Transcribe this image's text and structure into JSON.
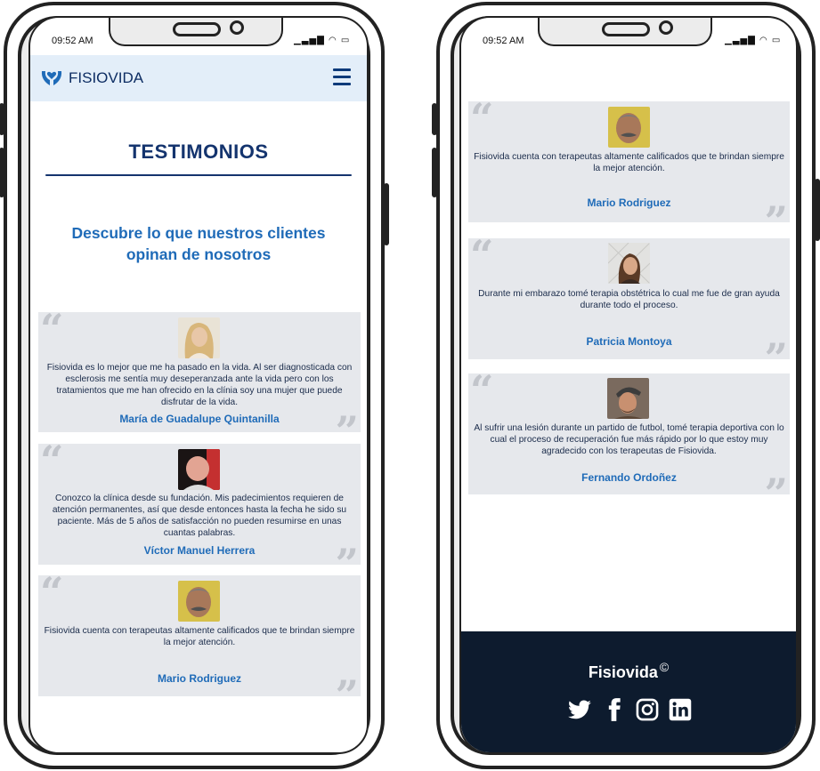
{
  "status_bar": {
    "time": "09:52 AM"
  },
  "header": {
    "brand": "FISIOVIDA"
  },
  "page": {
    "title": "TESTIMONIOS",
    "subtitle_line1": "Descubre lo que nuestros clientes",
    "subtitle_line2": "opinan de nosotros"
  },
  "testimonials": [
    {
      "text": "Fisiovida es lo mejor que me ha pasado en la vida. Al ser diagnosticada con esclerosis me sentía muy deseperanzada ante la vida pero con los tratamientos que me han ofrecido en la clínia soy una mujer que puede disfrutar de la vida.",
      "author": "María de Guadalupe Quintanilla"
    },
    {
      "text": "Conozco la clínica desde su fundación. Mis padecimientos requieren de atención permanentes, así que desde entonces hasta la fecha he sido su paciente. Más de 5 años de satisfacción no pueden resumirse en unas cuantas palabras.",
      "author": "Víctor Manuel Herrera"
    },
    {
      "text": "Fisiovida cuenta con terapeutas altamente calificados que te brindan siempre la mejor atención.",
      "author": "Mario Rodriguez"
    },
    {
      "text": "Durante mi embarazo tomé terapia obstétrica lo cual me fue de gran ayuda durante todo el proceso.",
      "author": "Patricia Montoya"
    },
    {
      "text": "Al sufrir una lesión durante un partido de futbol, tomé terapia deportiva con lo cual el proceso de recuperación fue más rápido por lo que estoy muy agradecido con los terapeutas de Fisiovida.",
      "author": "Fernando Ordoñez"
    }
  ],
  "footer": {
    "brand": "Fisiovida",
    "copyright_symbol": "©"
  },
  "icons": {
    "logo": "hands-heart-icon",
    "menu": "hamburger-menu-icon",
    "social": [
      "twitter-icon",
      "facebook-icon",
      "instagram-icon",
      "linkedin-icon"
    ]
  },
  "colors": {
    "nav_bg": "#e3eef9",
    "brand_dark": "#14346e",
    "accent": "#1f6bb8",
    "card_bg": "#e6e8ec",
    "footer_bg": "#0d1b2e"
  }
}
